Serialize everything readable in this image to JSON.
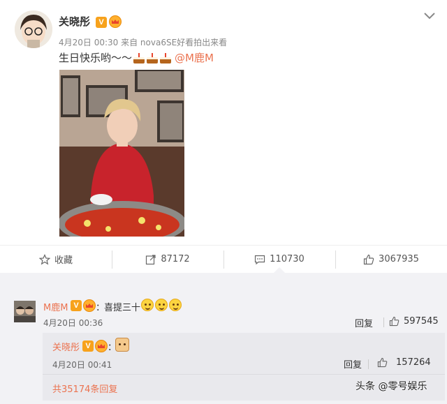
{
  "post": {
    "author": "关晓彤",
    "meta": "4月20日 00:30 来自 nova6SE好看拍出来看",
    "text": "生日快乐哟～～",
    "mention": "@M鹿M"
  },
  "actions": {
    "favorite": "收藏",
    "repost": "87172",
    "comment": "110730",
    "like": "3067935"
  },
  "comment": {
    "author": "M鹿M",
    "colon": "：",
    "text": "喜提三十",
    "time": "4月20日 00:36",
    "reply_label": "回复",
    "likes": "597545"
  },
  "sub_reply": {
    "author": "关晓彤",
    "colon": "：",
    "time": "4月20日 00:41",
    "reply_label": "回复",
    "likes": "157264",
    "more": "共35174条回复"
  },
  "watermark": "头条 @零号娱乐",
  "colors": {
    "accent": "#eb7350",
    "badge": "#f7a21c",
    "panel": "#f2f2f5"
  }
}
